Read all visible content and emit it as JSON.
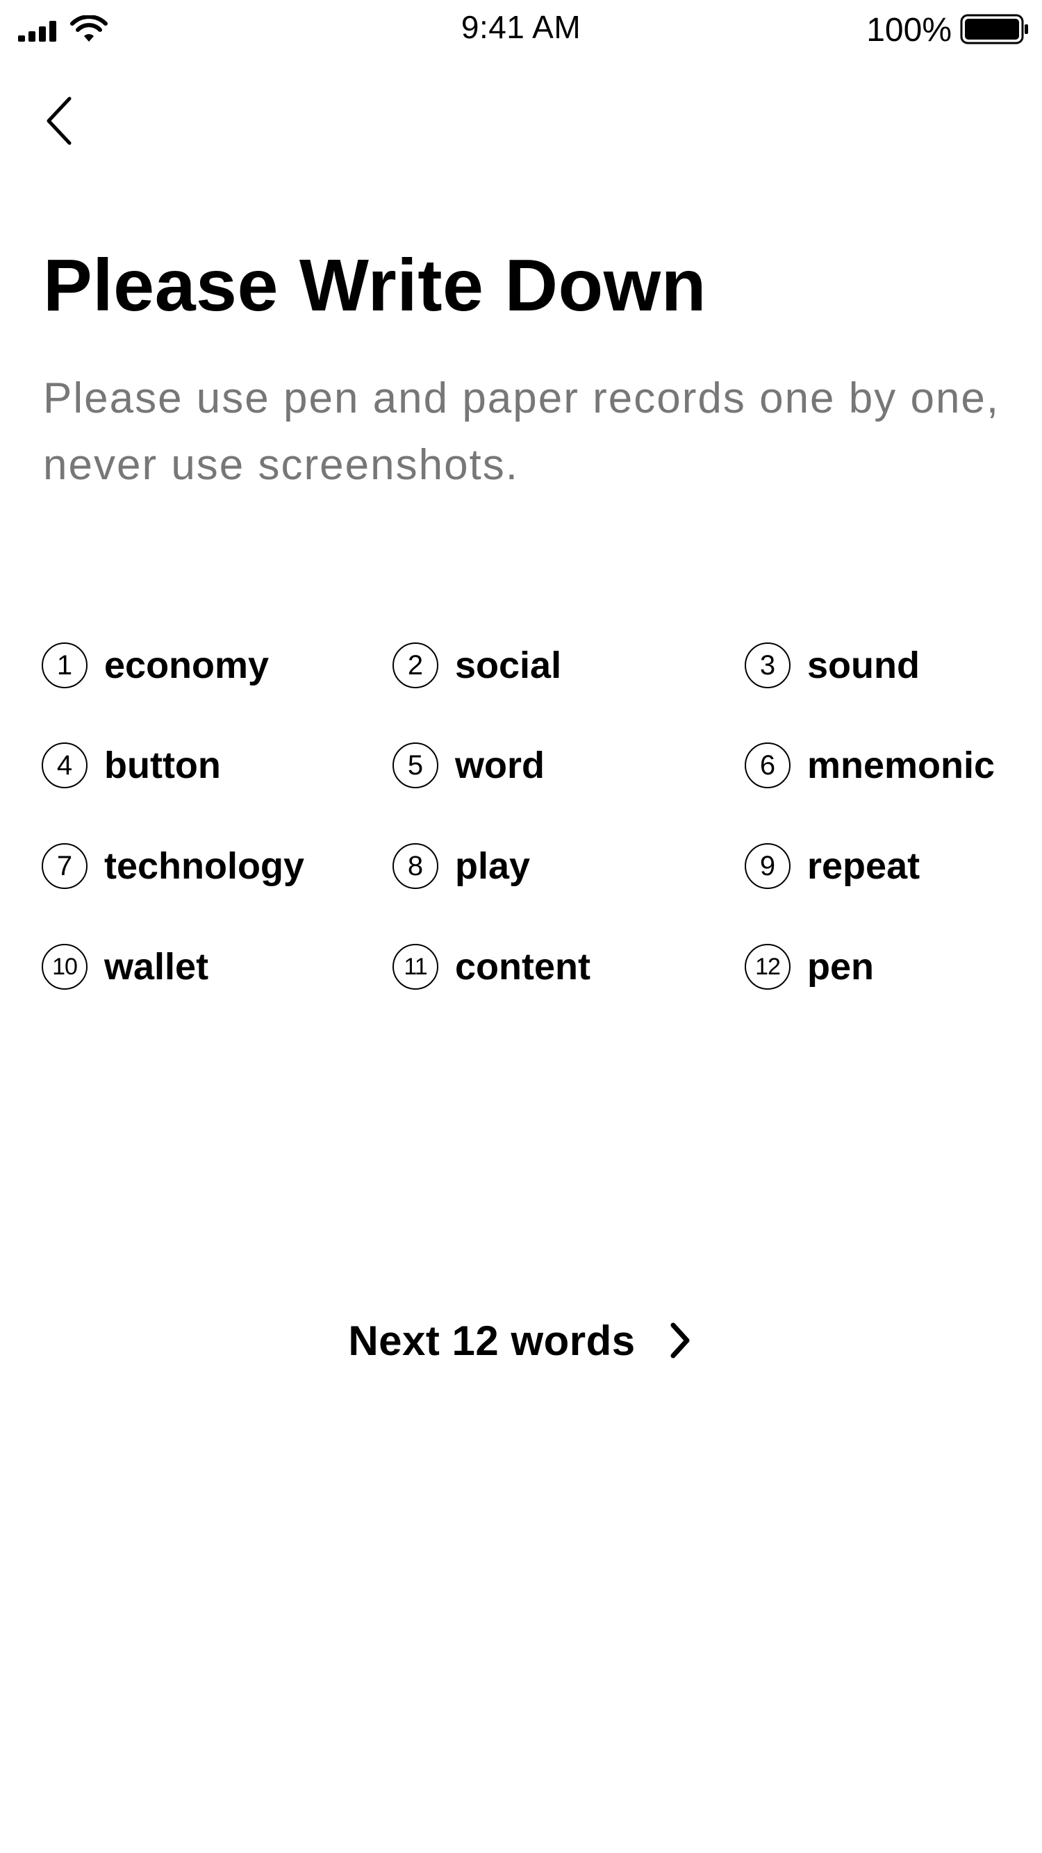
{
  "status_bar": {
    "time": "9:41 AM",
    "battery_percent": "100%",
    "battery_level": 1.0,
    "icons": [
      "signal-icon",
      "wifi-icon",
      "battery-icon"
    ]
  },
  "nav": {
    "back_icon": "chevron-left-icon"
  },
  "header": {
    "title": "Please Write Down",
    "subtitle": "Please use pen and paper records one by one, never use screenshots."
  },
  "words": [
    {
      "number": "1",
      "word": "economy"
    },
    {
      "number": "2",
      "word": "social"
    },
    {
      "number": "3",
      "word": "sound"
    },
    {
      "number": "4",
      "word": "button"
    },
    {
      "number": "5",
      "word": "word"
    },
    {
      "number": "6",
      "word": "mnemonic"
    },
    {
      "number": "7",
      "word": "technology"
    },
    {
      "number": "8",
      "word": "play"
    },
    {
      "number": "9",
      "word": "repeat"
    },
    {
      "number": "10",
      "word": "wallet"
    },
    {
      "number": "11",
      "word": "content"
    },
    {
      "number": "12",
      "word": "pen"
    }
  ],
  "next_button": {
    "label": "Next 12 words",
    "icon": "chevron-right-icon"
  },
  "colors": {
    "text": "#000000",
    "subtitle": "#777777",
    "background": "#ffffff"
  }
}
